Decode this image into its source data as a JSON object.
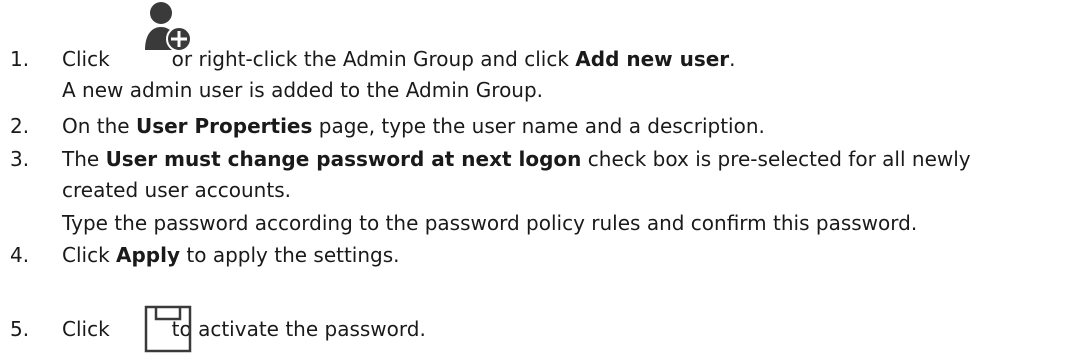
{
  "steps": [
    {
      "number": "1.",
      "lines": [
        {
          "before": "Click",
          "after_icon": "or right-click the Admin Group and click",
          "bold": "Add new user",
          "end": "."
        },
        {
          "text": "A new admin user is added to the Admin Group."
        }
      ],
      "icon": "add-user-icon"
    },
    {
      "number": "2.",
      "line": {
        "before": "On the",
        "bold": "User Properties",
        "after": "page, type the user name and a description."
      }
    },
    {
      "number": "3.",
      "lines": [
        {
          "before": "The",
          "bold": "User must change password at next logon",
          "after": "check box is pre-selected for all newly"
        },
        {
          "text": "created user accounts."
        },
        {
          "text": "Type the password according to the password policy rules and confirm this password."
        }
      ]
    },
    {
      "number": "4.",
      "line": {
        "before": "Click",
        "bold": "Apply",
        "after": "to apply the settings."
      }
    },
    {
      "number": "5.",
      "line": {
        "before": "Click",
        "after_icon": "to activate the password."
      },
      "icon": "save-icon"
    }
  ]
}
